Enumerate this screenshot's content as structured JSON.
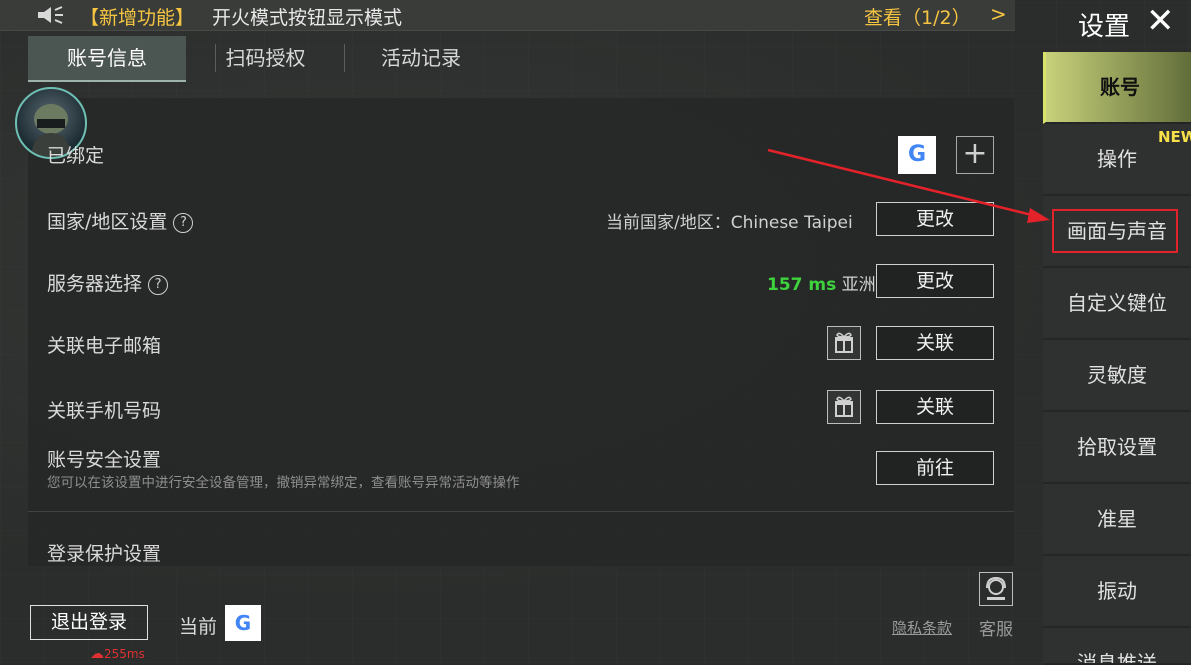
{
  "notice": {
    "tag": "【新增功能】",
    "message": "开火模式按钮显示模式",
    "view": "查看（1/2）",
    "chevron": ">"
  },
  "tabs": [
    {
      "label": "账号信息",
      "active": true
    },
    {
      "label": "扫码授权",
      "active": false
    },
    {
      "label": "活动记录",
      "active": false
    }
  ],
  "account": {
    "bound_label": "已绑定",
    "region": {
      "label": "国家/地区设置",
      "current": "当前国家/地区：Chinese Taipei",
      "button": "更改"
    },
    "server": {
      "label": "服务器选择",
      "ping": "157 ms",
      "region": "亚洲",
      "button": "更改"
    },
    "email": {
      "label": "关联电子邮箱",
      "button": "关联"
    },
    "phone": {
      "label": "关联手机号码",
      "button": "关联"
    },
    "security": {
      "label": "账号安全设置",
      "desc": "您可以在该设置中进行安全设备管理，撤销异常绑定，查看账号异常活动等操作",
      "button": "前往"
    },
    "login_protect": "登录保护设置"
  },
  "sidebar": {
    "title": "设置",
    "new_badge": "NEW",
    "items": [
      {
        "label": "账号",
        "active": true
      },
      {
        "label": "操作",
        "active": false
      },
      {
        "label": "画面与声音",
        "active": false
      },
      {
        "label": "自定义键位",
        "active": false
      },
      {
        "label": "灵敏度",
        "active": false
      },
      {
        "label": "拾取设置",
        "active": false
      },
      {
        "label": "准星",
        "active": false
      },
      {
        "label": "振动",
        "active": false
      },
      {
        "label": "消息推送",
        "active": false
      }
    ]
  },
  "footer": {
    "logout": "退出登录",
    "current": "当前",
    "ping": "255ms",
    "privacy": "隐私条款",
    "support": "客服"
  },
  "icons": {
    "google_letter": "G",
    "plus": "+",
    "help": "?",
    "close": "✕"
  },
  "colors": {
    "accent_yellow": "#f5c542",
    "ping_green": "#3ed23e",
    "highlight_red": "#e3222a"
  }
}
